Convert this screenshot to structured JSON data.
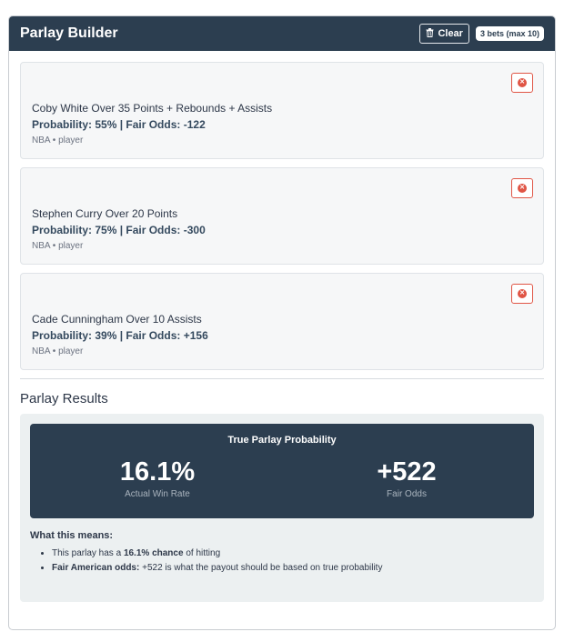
{
  "header": {
    "title": "Parlay Builder",
    "clear_label": "Clear",
    "bets_badge": "3 bets (max 10)"
  },
  "bets": [
    {
      "name": "Coby White Over 35 Points + Rebounds + Assists",
      "prob": "Probability: 55% | Fair Odds: -122",
      "meta": "NBA • player"
    },
    {
      "name": "Stephen Curry Over 20 Points",
      "prob": "Probability: 75% | Fair Odds: -300",
      "meta": "NBA • player"
    },
    {
      "name": "Cade Cunningham Over 10 Assists",
      "prob": "Probability: 39% | Fair Odds: +156",
      "meta": "NBA • player"
    }
  ],
  "results": {
    "title": "Parlay Results",
    "box_title": "True Parlay Probability",
    "win_rate_value": "16.1%",
    "win_rate_label": "Actual Win Rate",
    "fair_odds_value": "+522",
    "fair_odds_label": "Fair Odds",
    "meaning_title": "What this means:",
    "line1_pre": "This parlay has a ",
    "line1_bold": "16.1% chance",
    "line1_post": " of hitting",
    "line2_bold": "Fair American odds:",
    "line2_post": " +522 is what the payout should be based on true probability"
  },
  "colors": {
    "header_bg": "#2c3e50",
    "remove_accent": "#e05545",
    "results_bg": "#ecf0f1"
  },
  "icons": {
    "clear": "trash-icon",
    "remove": "close-circle-icon"
  }
}
